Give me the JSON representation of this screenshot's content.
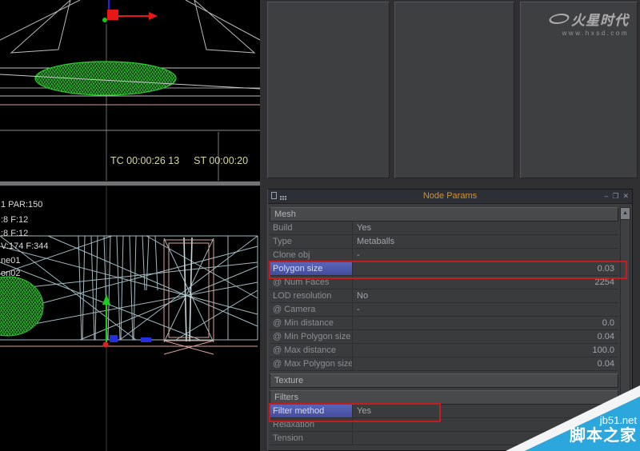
{
  "viewport_top": {
    "timecode_tc": "TC 00:00:26 13",
    "timecode_st": "ST 00:00:20"
  },
  "viewport_bottom": {
    "stats": [
      "1 PAR:150",
      ":8 F:12",
      ":8 F:12",
      "V:174 F:344",
      "ne01",
      "on02"
    ]
  },
  "node_params": {
    "title": "Node Params",
    "titlebar_icons": {
      "minimize": "–",
      "restore": "❐",
      "close": "✕",
      "scroll_up": "▲"
    },
    "sections": [
      {
        "header": "Mesh",
        "rows": [
          {
            "label": "Build",
            "value": "Yes",
            "align": "left",
            "highlight": false
          },
          {
            "label": "Type",
            "value": "Metaballs",
            "align": "left",
            "highlight": false
          },
          {
            "label": "Clone obj",
            "value": "-",
            "align": "left",
            "highlight": false
          },
          {
            "label": "Polygon size",
            "value": "0.03",
            "align": "right",
            "highlight": true
          },
          {
            "label": "@ Num Faces",
            "value": "2254",
            "align": "right",
            "highlight": false
          },
          {
            "label": "LOD resolution",
            "value": "No",
            "align": "left",
            "highlight": false
          },
          {
            "label": "@ Camera",
            "value": "-",
            "align": "left",
            "highlight": false
          },
          {
            "label": "@ Min distance",
            "value": "0.0",
            "align": "right",
            "highlight": false
          },
          {
            "label": "@ Min Polygon size",
            "value": "0.04",
            "align": "right",
            "highlight": false
          },
          {
            "label": "@ Max distance",
            "value": "100.0",
            "align": "right",
            "highlight": false
          },
          {
            "label": "@ Max Polygon size",
            "value": "0.04",
            "align": "right",
            "highlight": false
          }
        ]
      },
      {
        "header": "Texture",
        "rows": []
      },
      {
        "header": "Filters",
        "rows": [
          {
            "label": "Filter method",
            "value": "Yes",
            "align": "left",
            "highlight": true
          },
          {
            "label": "Relaxation",
            "value": "",
            "align": "left",
            "highlight": false
          },
          {
            "label": "Tension",
            "value": "",
            "align": "left",
            "highlight": false
          }
        ]
      }
    ]
  },
  "watermarks": {
    "hxsd_name": "火星时代",
    "hxsd_url": "www.hxsd.com",
    "jb51_url": "jb51.net",
    "jb51_name": "脚本之家"
  },
  "colors": {
    "accent_orange": "#cf9433",
    "highlight_blue": "#4f58a8",
    "annotation_red": "#c41d1d",
    "watermark_blue": "#2ba7dd",
    "wireframe_blue": "#a9c3cb",
    "mesh_green": "#2ecc2e",
    "timecode_yellow": "#d6d6a2"
  }
}
